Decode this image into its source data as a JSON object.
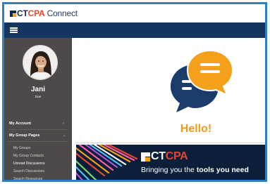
{
  "app": {
    "logo_prefix": "CT",
    "logo_accent": "CPA",
    "logo_suffix": " Connect"
  },
  "navbar": {
    "menu_icon": "hamburger-icon"
  },
  "profile": {
    "name": "Jani",
    "subtitle": "Doe",
    "avatar_icon": "user-photo"
  },
  "sidebar": {
    "my_account": "My Account",
    "my_group_pages": "My Group Pages",
    "items": [
      "My Groups",
      "My Group Contacts",
      "Unread Discussions",
      "Search Discussions",
      "Search Resources"
    ]
  },
  "main": {
    "greeting": "Hello!",
    "chat_icon": "chat-bubbles-icon"
  },
  "banner": {
    "logo_prefix": "CT",
    "logo_accent": "CPA",
    "tagline_start": "Bringing you the ",
    "tagline_strong": "tools you need"
  },
  "colors": {
    "brand_navy": "#13355f",
    "accent_orange": "#f09a16",
    "logo_red": "#e8452c",
    "sidebar_bg": "#4d4a49",
    "frame_blue": "#2f7fc7"
  }
}
